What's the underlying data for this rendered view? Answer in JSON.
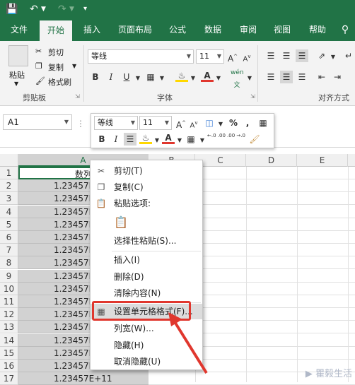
{
  "tabs": [
    "文件",
    "开始",
    "插入",
    "页面布局",
    "公式",
    "数据",
    "审阅",
    "视图",
    "帮助"
  ],
  "ribbon": {
    "paste": "粘贴",
    "cut": "剪切",
    "copy": "复制",
    "format_painter": "格式刷",
    "clipboard_label": "剪贴板",
    "font_name": "等线",
    "font_size": "11",
    "font_label": "字体",
    "align_label": "对齐方式",
    "bold": "B",
    "italic": "I",
    "underline": "U",
    "wen": "wén",
    "a_up": "A",
    "a_down": "A"
  },
  "namebox": "A1",
  "mini_toolbar": {
    "font_name": "等线",
    "font_size": "11",
    "percent": "%",
    "comma": ",",
    "bold": "B",
    "italic": "I",
    "dec_inc": "←.0 .00",
    "dec_dec": ".00 →.0"
  },
  "columns": [
    "A",
    "B",
    "C",
    "D",
    "E"
  ],
  "rows": [
    {
      "num": "1",
      "a": "数列"
    },
    {
      "num": "2",
      "a": "1.23457E+11"
    },
    {
      "num": "3",
      "a": "1.23457E+11"
    },
    {
      "num": "4",
      "a": "1.23457E+11"
    },
    {
      "num": "5",
      "a": "1.23457E+11"
    },
    {
      "num": "6",
      "a": "1.23457E+11"
    },
    {
      "num": "7",
      "a": "1.23457E+11"
    },
    {
      "num": "8",
      "a": "1.23457E+11"
    },
    {
      "num": "9",
      "a": "1.23457E+11"
    },
    {
      "num": "10",
      "a": "1.23457E+11"
    },
    {
      "num": "11",
      "a": "1.23457E+11"
    },
    {
      "num": "12",
      "a": "1.23457E+11"
    },
    {
      "num": "13",
      "a": "1.23457E+11"
    },
    {
      "num": "14",
      "a": "1.23457E+11"
    },
    {
      "num": "15",
      "a": "1.23457E+11"
    },
    {
      "num": "16",
      "a": "1.23457E+11"
    },
    {
      "num": "17",
      "a": "1.23457E+11"
    }
  ],
  "context_menu": {
    "cut": "剪切(T)",
    "copy": "复制(C)",
    "paste_options": "粘贴选项:",
    "paste_special": "选择性粘贴(S)...",
    "insert": "插入(I)",
    "delete": "删除(D)",
    "clear": "清除内容(N)",
    "format_cells": "设置单元格格式(F)...",
    "col_width": "列宽(W)...",
    "hide": "隐藏(H)",
    "unhide": "取消隐藏(U)"
  },
  "watermark": "瞿毅生活",
  "colors": {
    "accent": "#217346",
    "highlight": "#e0372e"
  }
}
